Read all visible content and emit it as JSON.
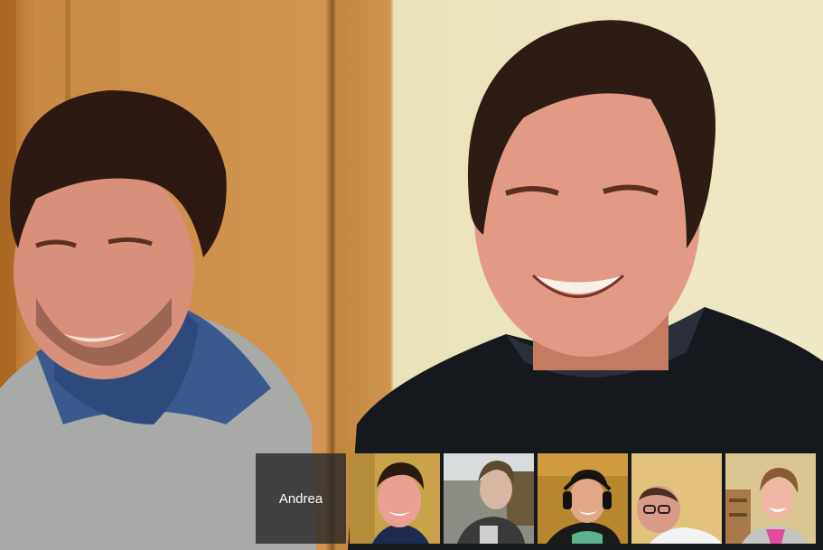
{
  "main_video": {
    "participants": [
      "person-left",
      "person-right"
    ]
  },
  "filmstrip": {
    "active_speaker_name": "Andrea",
    "thumbnails": [
      {
        "name": "participant-1",
        "bg": "#c9a24a"
      },
      {
        "name": "participant-2",
        "bg": "#8b8c83"
      },
      {
        "name": "participant-3",
        "bg": "#b7872f"
      },
      {
        "name": "participant-4",
        "bg": "#e2c27c"
      },
      {
        "name": "participant-5",
        "bg": "#d9c690"
      }
    ]
  }
}
